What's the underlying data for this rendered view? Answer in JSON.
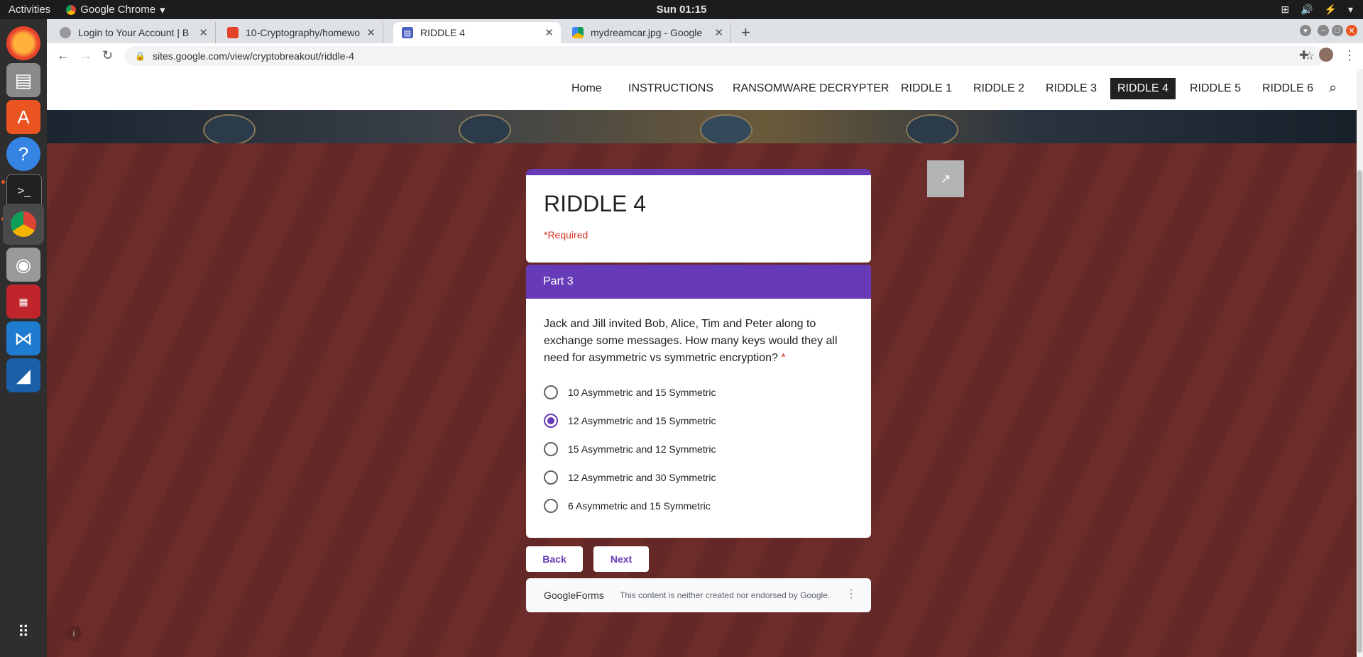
{
  "system_bar": {
    "activities": "Activities",
    "app_name": "Google Chrome",
    "clock": "Sun 01:15"
  },
  "browser": {
    "tabs": [
      {
        "title": "Login to Your Account | B",
        "favicon": "circle-icon"
      },
      {
        "title": "10-Cryptography/homewo",
        "favicon": "gitlab-icon"
      },
      {
        "title": "RIDDLE 4",
        "favicon": "google-sites-icon"
      },
      {
        "title": "mydreamcar.jpg - Google",
        "favicon": "google-drive-icon"
      }
    ],
    "url": "sites.google.com/view/cryptobreakout/riddle-4"
  },
  "site_nav": {
    "links": [
      "Home",
      "INSTRUCTIONS",
      "RANSOMWARE DECRYPTER",
      "RIDDLE 1",
      "RIDDLE 2",
      "RIDDLE 3",
      "RIDDLE 4",
      "RIDDLE 5",
      "RIDDLE 6"
    ],
    "current": "RIDDLE 4"
  },
  "form": {
    "title": "RIDDLE 4",
    "required_note": "*Required",
    "section_title": "Part 3",
    "question": "Jack and Jill invited Bob, Alice, Tim and Peter along to exchange some messages. How many keys would they all need for asymmetric vs symmetric encryption?",
    "required_star": "*",
    "options": [
      "10 Asymmetric and 15 Symmetric",
      "12 Asymmetric and 15 Symmetric",
      "15 Asymmetric and 12 Symmetric",
      "12 Asymmetric and 30 Symmetric",
      "6 Asymmetric and 15 Symmetric"
    ],
    "selected_option": "12 Asymmetric and 15 Symmetric",
    "back_label": "Back",
    "next_label": "Next",
    "footer_brand": "GoogleForms",
    "footer_disclaimer": "This content is neither created nor endorsed by Google."
  },
  "colors": {
    "accent": "#673ab7",
    "required": "#d93025",
    "page_background": "#6b2b29"
  }
}
